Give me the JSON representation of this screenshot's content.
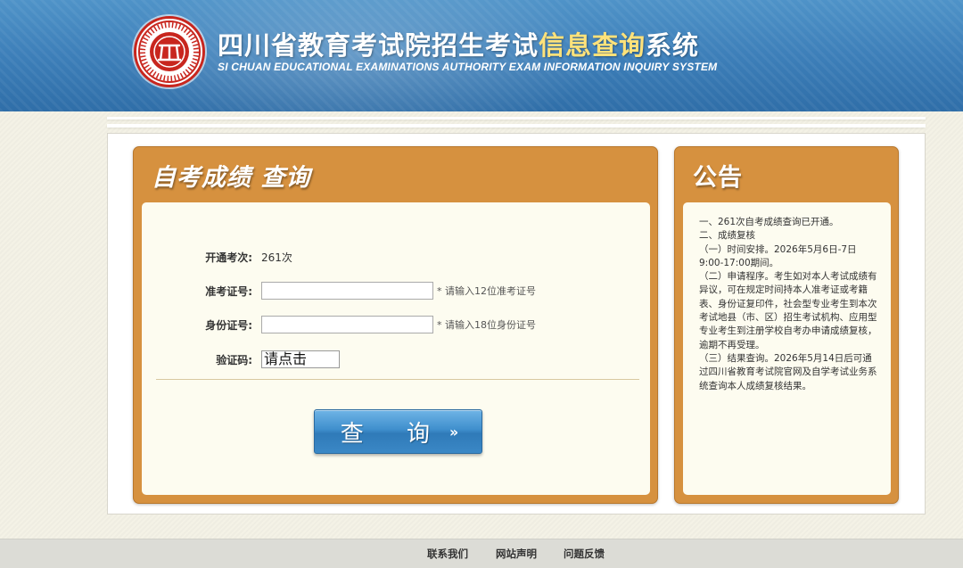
{
  "header": {
    "title_main": "四川省教育考试院招生考试",
    "title_highlight": "信息查询",
    "title_end": "系统",
    "subtitle": "SI CHUAN EDUCATIONAL EXAMINATIONS AUTHORITY EXAM INFORMATION INQUIRY SYSTEM",
    "logo_icon": "seal-logo-icon",
    "colors": {
      "header_blue": "#3d7fb9",
      "highlight": "#ffe27a",
      "seal_red": "#c8261e"
    }
  },
  "query_panel": {
    "title": "自考成绩 查询",
    "session_label": "开通考次:",
    "session_value": "261次",
    "admission_label": "准考证号:",
    "admission_value": "",
    "admission_hint": "* 请输入12位准考证号",
    "id_label": "身份证号:",
    "id_value": "",
    "id_hint": "* 请输入18位身份证号",
    "captcha_label": "验证码:",
    "captcha_text": "请点击",
    "button_label": "查 询",
    "button_icon": "double-chevron-right-icon",
    "button_arrow": "››",
    "colors": {
      "panel_orange": "#d6913f",
      "panel_inner": "#fdfcf0",
      "button_blue": "#3f8fcd"
    }
  },
  "notice_panel": {
    "title": "公告",
    "lines": [
      "一、261次自考成绩查询已开通。",
      "二、成绩复核",
      "（一）时间安排。2026年5月6日-7日9:00-17:00期间。",
      "（二）申请程序。考生如对本人考试成绩有异议，可在规定时间持本人准考证或考籍表、身份证复印件，社会型专业考生到本次考试地县（市、区）招生考试机构、应用型专业考生到注册学校自考办申请成绩复核，逾期不再受理。",
      "（三）结果查询。2026年5月14日后可通过四川省教育考试院官网及自学考试业务系统查询本人成绩复核结果。"
    ]
  },
  "footer": {
    "links": [
      "联系我们",
      "网站声明",
      "问题反馈"
    ]
  }
}
